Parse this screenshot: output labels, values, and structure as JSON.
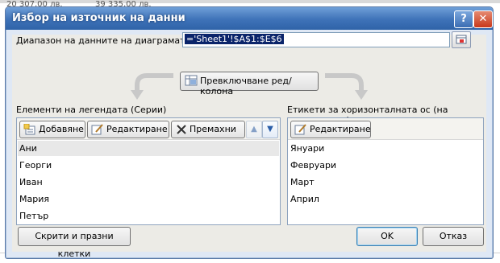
{
  "background_sheet": {
    "cell_1": "20 307,00 лв.",
    "cell_2": "39 335,00 лв."
  },
  "dialog": {
    "title": "Избор на източник на данни",
    "help_label": "?",
    "close_label": "✕",
    "range_label": "Диапазон на данните на диаграмата:",
    "range_value": "='Sheet1'!$A$1:$E$6",
    "switch_button": "Превключване ред/колона",
    "legend_section_label": "Елементи на легендата (Серии)",
    "legend_toolbar": {
      "add": "Добавяне",
      "edit": "Редактиране",
      "remove": "Премахни"
    },
    "legend_items": [
      "Ани",
      "Георги",
      "Иван",
      "Мария",
      "Петър"
    ],
    "axis_section_label": "Етикети за хоризонталната ос (на категориите)",
    "axis_toolbar": {
      "edit": "Редактиране"
    },
    "axis_items": [
      "Януари",
      "Февруари",
      "Март",
      "Април"
    ],
    "hidden_cells_button": "Скрити и празни клетки",
    "ok_button": "OK",
    "cancel_button": "Отказ"
  },
  "colors": {
    "title_bar": "#3e72b8",
    "dialog_bg": "#ecebe6",
    "selection": "#0a246a"
  }
}
